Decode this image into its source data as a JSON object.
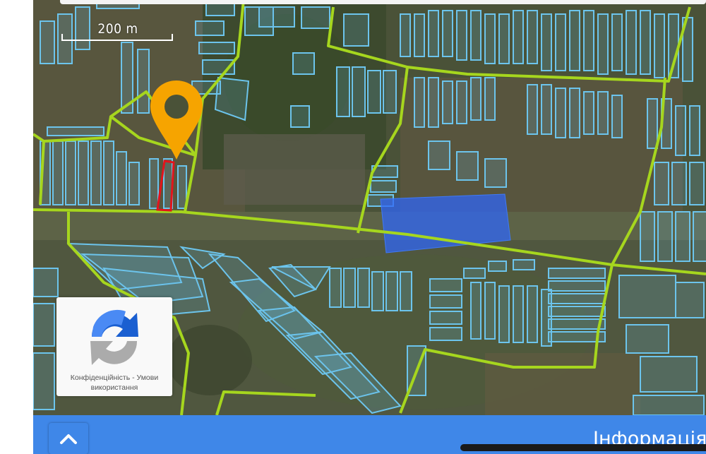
{
  "scale": {
    "label": "200 m"
  },
  "recaptcha": {
    "text_line1": "Конфіденційність - Умови",
    "text_line2": "використання"
  },
  "bottom_bar": {
    "info_label": "Інформація",
    "up_icon": "chevron-up-icon"
  },
  "colors": {
    "boundary": "#a6d61e",
    "parcel": "#6cc4ec",
    "selected_parcel": "#e3141b",
    "marker": "#f6a400",
    "highlight": "#2f65f5",
    "bar": "#3f87e8"
  }
}
